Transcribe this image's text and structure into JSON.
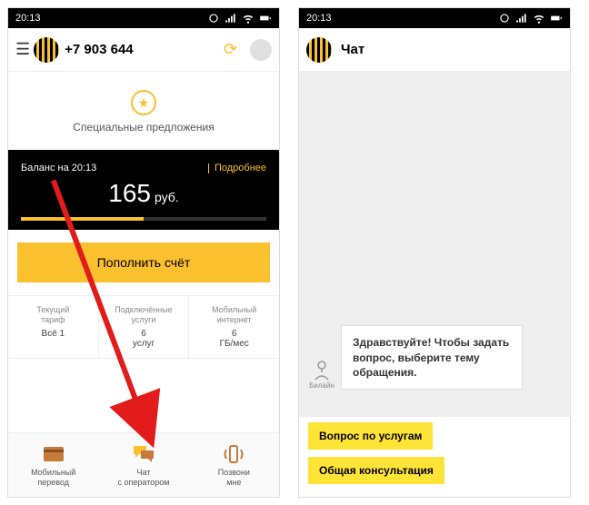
{
  "statusbar": {
    "time": "20:13"
  },
  "left": {
    "phone_number": "+7 903 644",
    "offers_label": "Специальные предложения",
    "balance_label": "Баланс на 20:13",
    "more_label": "Подробнее",
    "balance_value": "165",
    "currency": "руб.",
    "topup_label": "Пополнить счёт",
    "info": [
      {
        "label": "Текущий\nтариф",
        "value": "Всё 1"
      },
      {
        "label": "Подключённые\nуслуги",
        "value": "6\nуслуг"
      },
      {
        "label": "Мобильный\nинтернет",
        "value": "6\nГБ/мес"
      }
    ],
    "nav": [
      {
        "label": "Мобильный\nперевод"
      },
      {
        "label": "Чат\nс оператором"
      },
      {
        "label": "Позвони\nмне"
      }
    ]
  },
  "right": {
    "title": "Чат",
    "avatar_label": "Билайн",
    "message": "Здравствуйте! Чтобы задать вопрос, выберите тему обращения.",
    "chips": [
      "Вопрос по услугам",
      "Общая консультация"
    ]
  }
}
